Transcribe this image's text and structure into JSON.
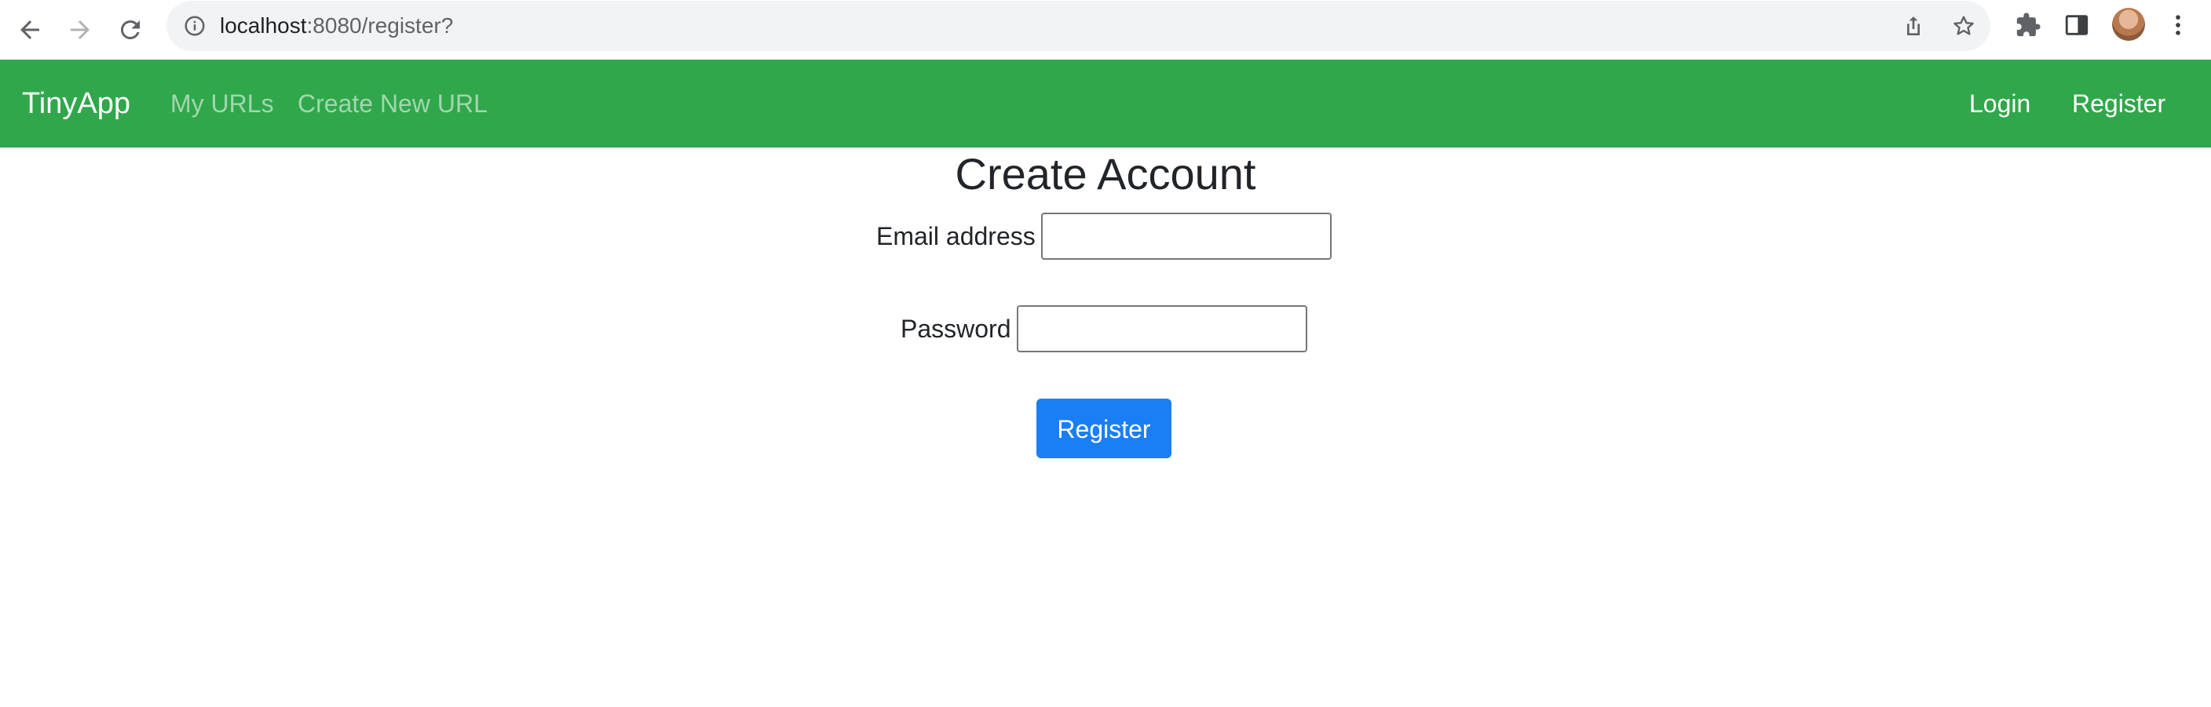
{
  "browser": {
    "url_host": "localhost",
    "url_rest": ":8080/register?",
    "icons": {
      "back": "back-arrow-icon",
      "forward": "forward-arrow-icon",
      "reload": "reload-icon",
      "info": "info-icon",
      "share": "share-icon",
      "bookmark": "star-icon",
      "extensions": "puzzle-icon",
      "side_panel": "side-panel-icon",
      "profile": "avatar",
      "menu": "kebab-menu-icon"
    }
  },
  "navbar": {
    "brand": "TinyApp",
    "links": {
      "my_urls": "My URLs",
      "create_new_url": "Create New URL",
      "login": "Login",
      "register": "Register"
    },
    "colors": {
      "background": "#30a74b"
    }
  },
  "main": {
    "title": "Create Account",
    "form": {
      "email_label": "Email address",
      "email_value": "",
      "password_label": "Password",
      "password_value": "",
      "submit_label": "Register"
    },
    "colors": {
      "submit_button": "#1a7ff5"
    }
  }
}
